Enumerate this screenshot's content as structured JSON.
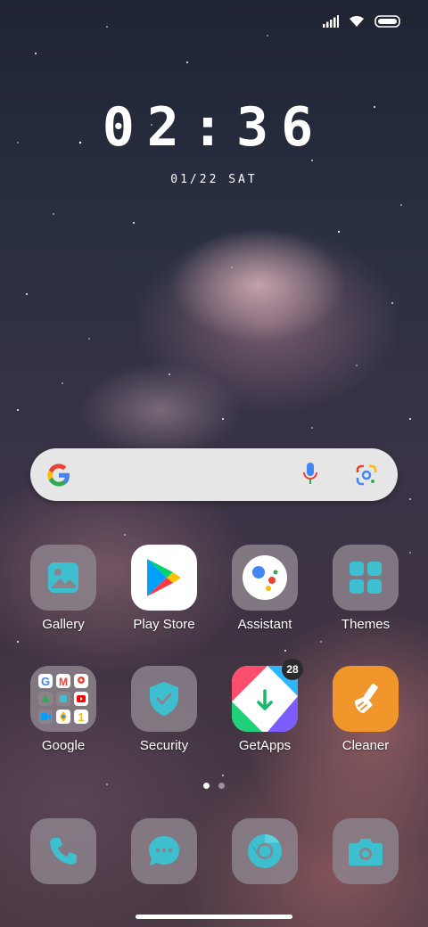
{
  "status_bar": {
    "signal_icon": "signal-icon",
    "wifi_icon": "wifi-icon",
    "battery_icon": "battery-icon"
  },
  "clock": {
    "time": "02:36",
    "date": "01/22 SAT"
  },
  "search_bar": {
    "logo": "google-logo-icon",
    "mic_icon": "mic-icon",
    "lens_icon": "lens-icon"
  },
  "apps_row1": [
    {
      "label": "Gallery",
      "icon": "gallery-icon"
    },
    {
      "label": "Play Store",
      "icon": "play-store-icon"
    },
    {
      "label": "Assistant",
      "icon": "assistant-icon"
    },
    {
      "label": "Themes",
      "icon": "themes-icon"
    }
  ],
  "apps_row2": [
    {
      "label": "Google",
      "icon": "google-folder-icon"
    },
    {
      "label": "Security",
      "icon": "security-icon"
    },
    {
      "label": "GetApps",
      "icon": "getapps-icon",
      "badge": "28"
    },
    {
      "label": "Cleaner",
      "icon": "cleaner-icon"
    }
  ],
  "page_indicator": {
    "pages": 2,
    "current": 1
  },
  "dock": [
    {
      "icon": "phone-icon"
    },
    {
      "icon": "messages-icon"
    },
    {
      "icon": "chrome-icon"
    },
    {
      "icon": "camera-icon"
    }
  ],
  "colors": {
    "accent": "#3dbfd0",
    "icon_tile": "#8c828c",
    "cleaner": "#f0962a"
  }
}
